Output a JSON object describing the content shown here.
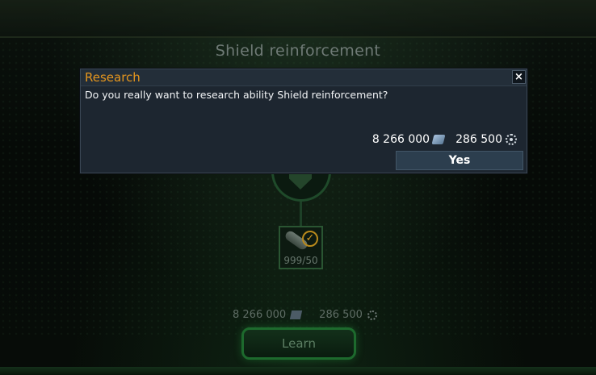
{
  "scene": {
    "title": "Shield reinforcement",
    "item_count": "999/50",
    "cost_primary": "8 266 000",
    "cost_secondary": "286 500",
    "learn_label": "Learn"
  },
  "dialog": {
    "title": "Research",
    "close_glyph": "×",
    "message": "Do you really want to research ability Shield reinforcement?",
    "cost_primary": "8 266 000",
    "cost_secondary": "286 500",
    "confirm_label": "Yes"
  },
  "colors": {
    "dialog_title": "#e5961e",
    "dialog_bg": "#1d2630",
    "button_bg": "#2c3e4e",
    "accent_green": "#1d6a2d"
  },
  "icons": {
    "primary_currency": "credits-icon",
    "secondary_currency": "gear-icon",
    "ability": "shield-icon",
    "completed": "check-icon"
  }
}
